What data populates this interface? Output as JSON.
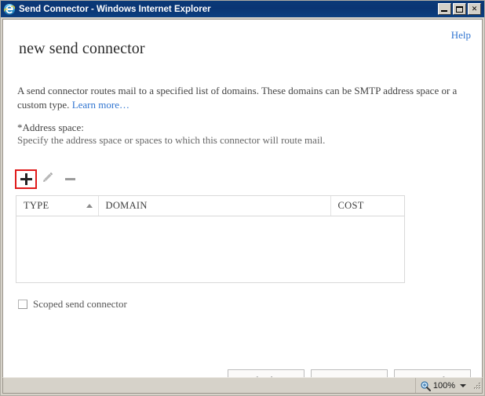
{
  "window": {
    "title": "Send Connector - Windows Internet Explorer",
    "app_icon": "internet-explorer-icon",
    "controls": {
      "minimize_label": "_",
      "maximize_label": "□",
      "close_label": "✕"
    }
  },
  "page": {
    "help_label": "Help",
    "title": "new send connector",
    "intro_text_1": "A send connector routes mail to a specified list of domains. These domains can be SMTP address space or a custom type. ",
    "learn_more_label": "Learn more…",
    "address_space_label": "*Address space:",
    "address_space_hint": "Specify the address space or spaces to which this connector will route mail."
  },
  "toolbar": {
    "add_icon": "plus-icon",
    "edit_icon": "pencil-icon",
    "remove_icon": "minus-icon",
    "highlight_color": "#e01b1b",
    "add_enabled": true,
    "edit_enabled": false,
    "remove_enabled": false
  },
  "table": {
    "columns": [
      {
        "label": "TYPE",
        "sorted": true,
        "sort_direction": "asc"
      },
      {
        "label": "DOMAIN",
        "sorted": false,
        "sort_direction": ""
      },
      {
        "label": "COST",
        "sorted": false,
        "sort_direction": ""
      }
    ],
    "rows": []
  },
  "scoped": {
    "label": "Scoped send connector",
    "checked": false
  },
  "footer": {
    "back_label": "back",
    "next_label": "next",
    "cancel_label": "cancel"
  },
  "statusbar": {
    "zoom_label": "100%",
    "zoom_icon": "magnifier-icon",
    "caret_icon": "chevron-down-icon",
    "resize_grip_icon": "resize-grip-icon"
  },
  "colors": {
    "titlebar": "#0b3a78",
    "link": "#2f74d0",
    "chrome": "#d6d2c9",
    "page_bg": "#ffffff",
    "grid_border": "#d9d9d9"
  }
}
